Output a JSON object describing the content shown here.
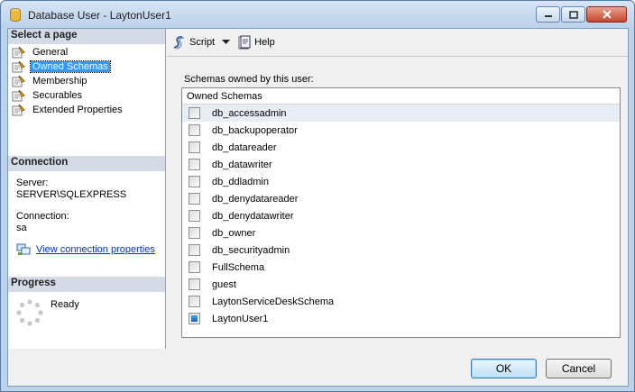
{
  "window": {
    "title": "Database User - LaytonUser1",
    "icon": "database-cylinder-icon",
    "controls": [
      "minimize-icon",
      "maximize-icon",
      "close-icon"
    ]
  },
  "left_panel": {
    "select_page_header": "Select a page",
    "pages": [
      {
        "label": "General",
        "icon": "page-icon",
        "selected": false
      },
      {
        "label": "Owned Schemas",
        "icon": "page-icon",
        "selected": true
      },
      {
        "label": "Membership",
        "icon": "page-icon",
        "selected": false
      },
      {
        "label": "Securables",
        "icon": "page-icon",
        "selected": false
      },
      {
        "label": "Extended Properties",
        "icon": "page-icon",
        "selected": false
      }
    ],
    "connection_header": "Connection",
    "server_label": "Server:",
    "server_value": "SERVER\\SQLEXPRESS",
    "connection_label": "Connection:",
    "connection_value": "sa",
    "view_connection_link": "View connection properties",
    "progress_header": "Progress",
    "progress_status": "Ready"
  },
  "toolbar": {
    "script_label": "Script",
    "help_label": "Help"
  },
  "main": {
    "schemas_label": "Schemas owned by this user:",
    "grid_header": "Owned Schemas",
    "schemas": [
      {
        "name": "db_accessadmin",
        "checked": false
      },
      {
        "name": "db_backupoperator",
        "checked": false
      },
      {
        "name": "db_datareader",
        "checked": false
      },
      {
        "name": "db_datawriter",
        "checked": false
      },
      {
        "name": "db_ddladmin",
        "checked": false
      },
      {
        "name": "db_denydatareader",
        "checked": false
      },
      {
        "name": "db_denydatawriter",
        "checked": false
      },
      {
        "name": "db_owner",
        "checked": false
      },
      {
        "name": "db_securityadmin",
        "checked": false
      },
      {
        "name": "FullSchema",
        "checked": false
      },
      {
        "name": "guest",
        "checked": false
      },
      {
        "name": "LaytonServiceDeskSchema",
        "checked": false
      },
      {
        "name": "LaytonUser1",
        "checked": true
      }
    ]
  },
  "buttons": {
    "ok": "OK",
    "cancel": "Cancel"
  },
  "colors": {
    "accent": "#3399ff",
    "section_header": "#d4dbe7",
    "link": "#0033cc"
  }
}
